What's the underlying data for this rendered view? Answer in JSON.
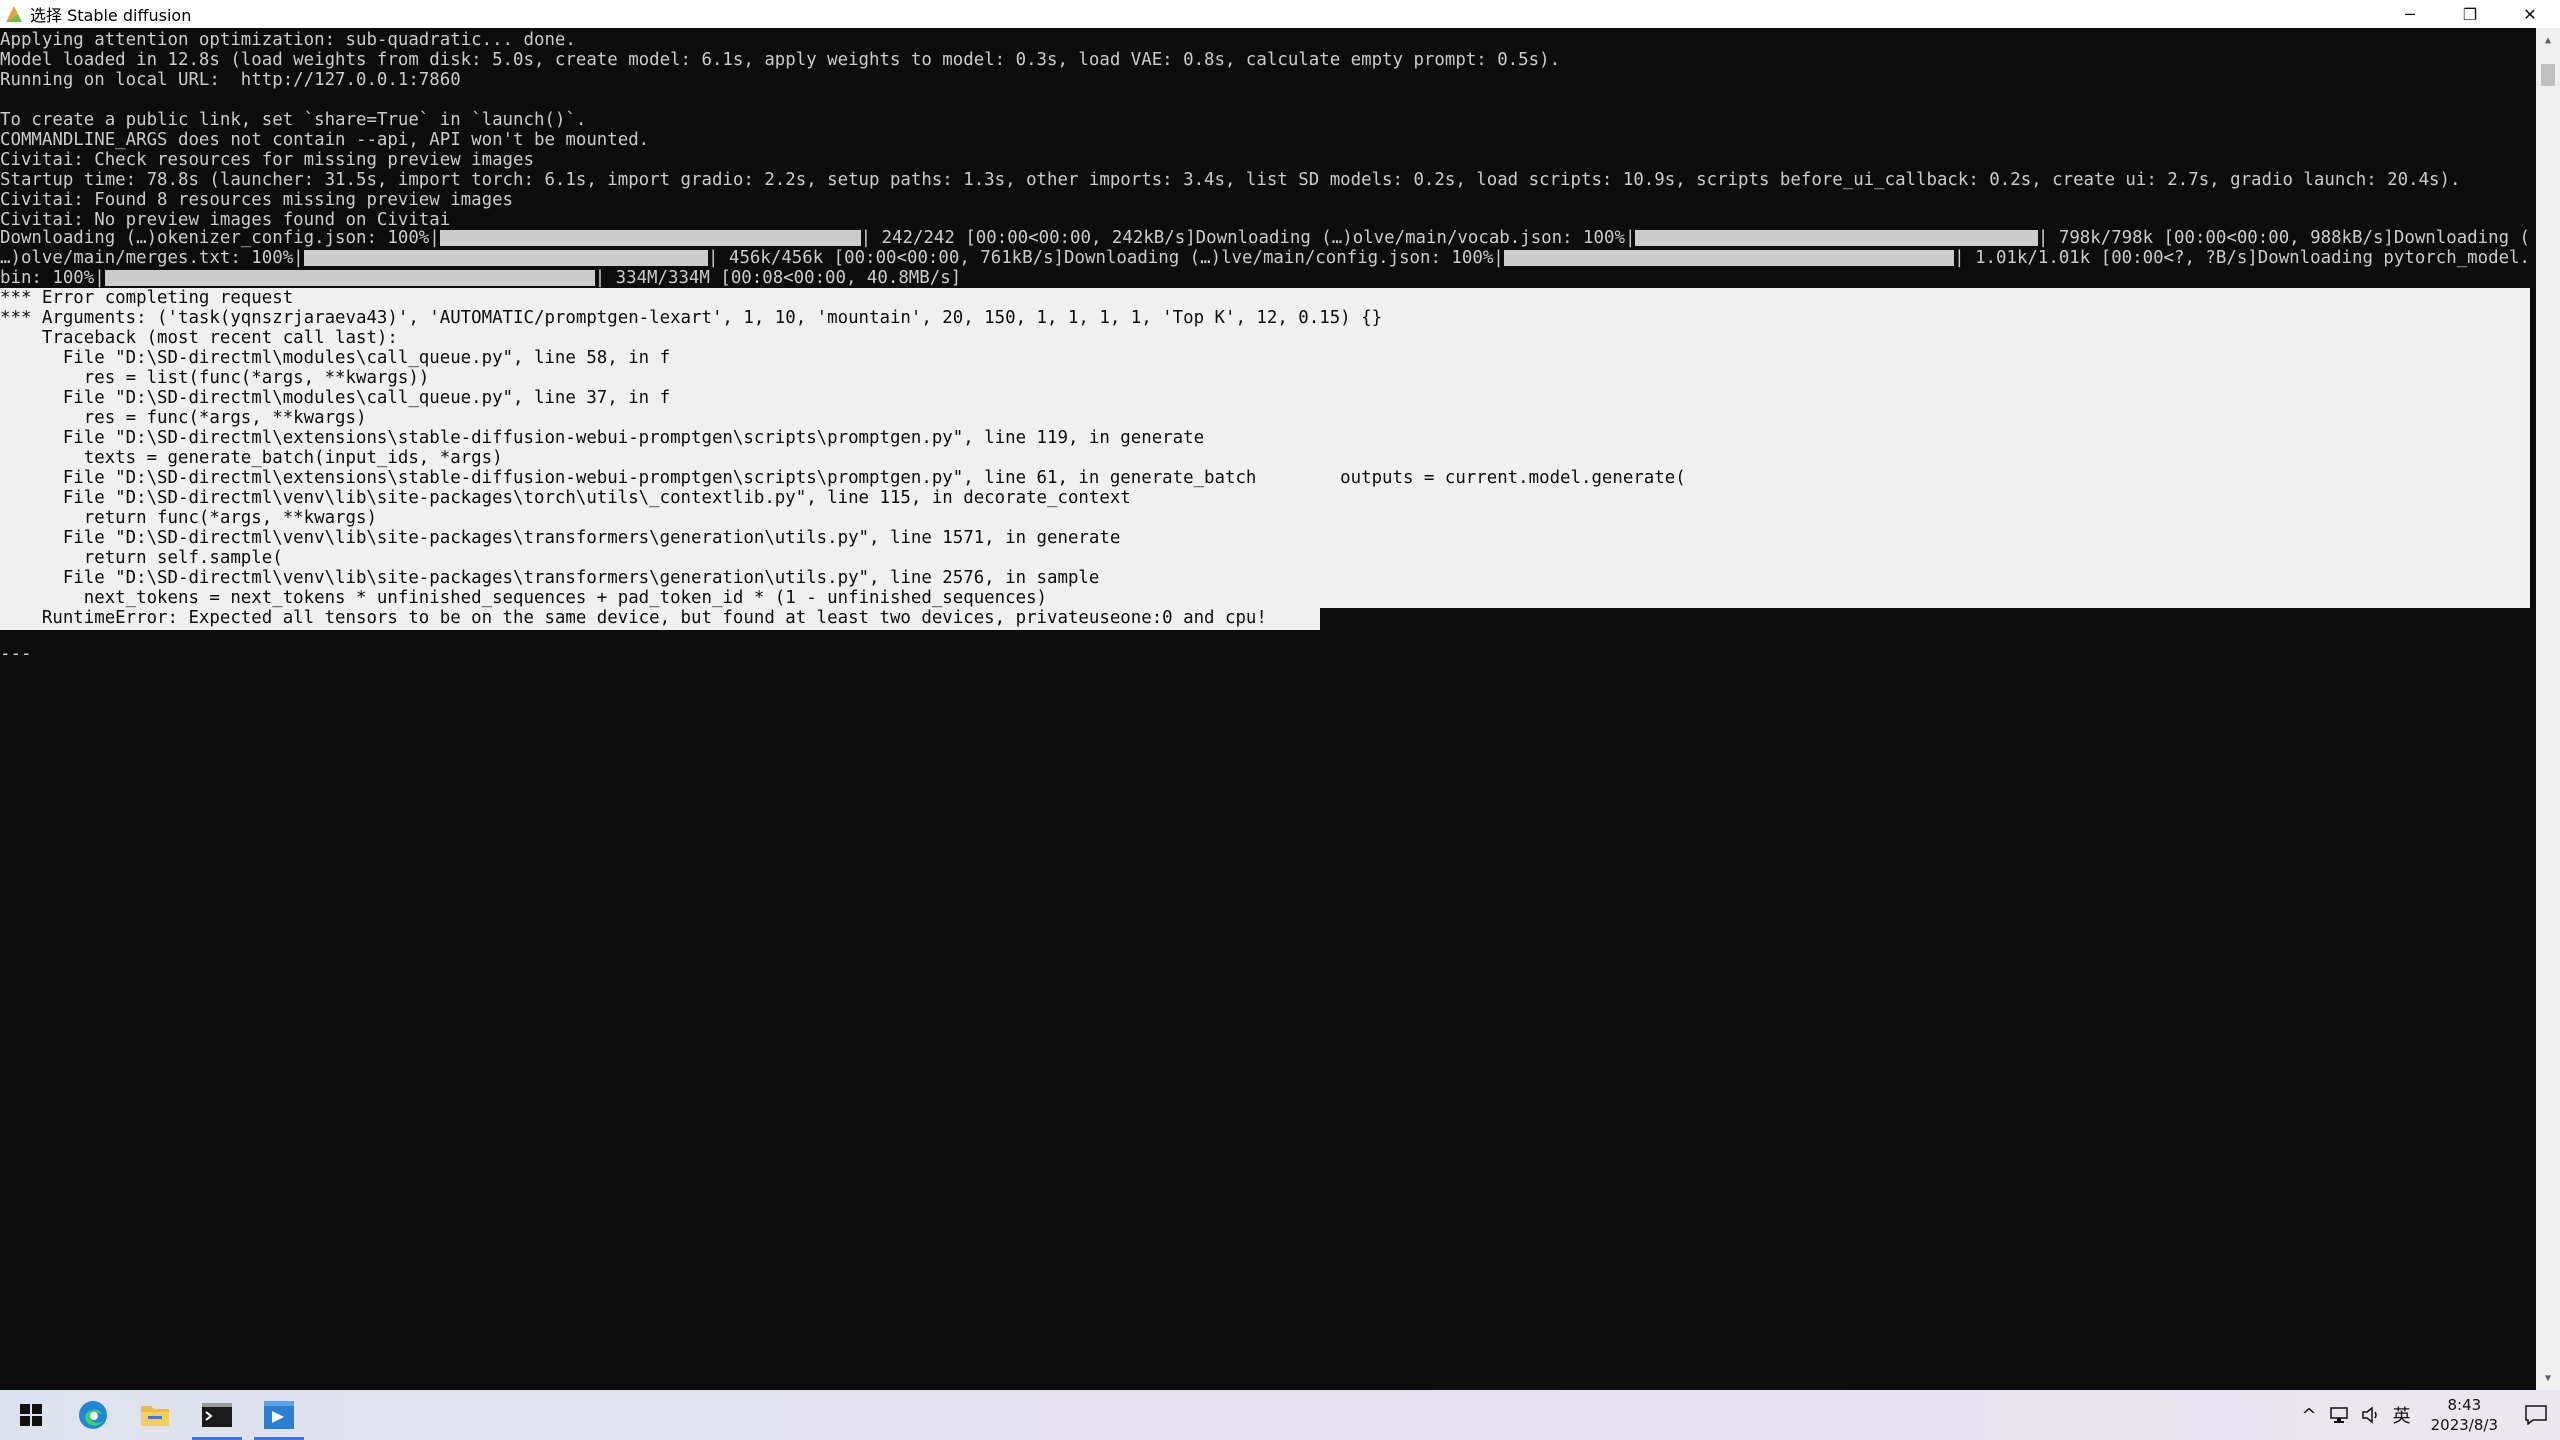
{
  "window": {
    "title": "选择 Stable diffusion",
    "minimize_glyph": "─",
    "maximize_glyph": "❐",
    "close_glyph": "✕"
  },
  "console": {
    "pre_lines": [
      "Applying attention optimization: sub-quadratic... done.",
      "Model loaded in 12.8s (load weights from disk: 5.0s, create model: 6.1s, apply weights to model: 0.3s, load VAE: 0.8s, calculate empty prompt: 0.5s).",
      "Running on local URL:  http://127.0.0.1:7860",
      "",
      "To create a public link, set `share=True` in `launch()`.",
      "COMMANDLINE_ARGS does not contain --api, API won't be mounted.",
      "Civitai: Check resources for missing preview images",
      "Startup time: 78.8s (launcher: 31.5s, import torch: 6.1s, import gradio: 2.2s, setup paths: 1.3s, other imports: 3.4s, list SD models: 0.2s, load scripts: 10.9s, scripts before_ui_callback: 0.2s, create ui: 2.7s, gradio launch: 20.4s).",
      "Civitai: Found 8 resources missing preview images",
      "Civitai: No preview images found on Civitai"
    ],
    "downloads": {
      "row1": {
        "a": "Downloading (…)okenizer_config.json: 100%|",
        "b": "| 242/242 [00:00<00:00, 242kB/s]Downloading (…)olve/main/vocab.json: 100%|",
        "c": "| 798k/798k [00:00<00:00, 988kB/s]Downloading ("
      },
      "row2": {
        "a": "…)olve/main/merges.txt: 100%|",
        "b": "| 456k/456k [00:00<00:00, 761kB/s]Downloading (…)lve/main/config.json: 100%|",
        "c": "| 1.01k/1.01k [00:00<?, ?B/s]Downloading pytorch_model."
      },
      "row3": {
        "a": "bin: 100%|",
        "b": "| 334M/334M [00:08<00:00, 40.8MB/s]"
      },
      "progress": [
        1.0,
        1.0,
        1.0,
        1.0,
        1.0,
        1.0
      ]
    },
    "error_lines": [
      "*** Error completing request",
      "*** Arguments: ('task(yqnszrjaraeva43)', 'AUTOMATIC/promptgen-lexart', 1, 10, 'mountain', 20, 150, 1, 1, 1, 1, 'Top K', 12, 0.15) {}",
      "    Traceback (most recent call last):",
      "      File \"D:\\SD-directml\\modules\\call_queue.py\", line 58, in f",
      "        res = list(func(*args, **kwargs))",
      "      File \"D:\\SD-directml\\modules\\call_queue.py\", line 37, in f",
      "        res = func(*args, **kwargs)",
      "      File \"D:\\SD-directml\\extensions\\stable-diffusion-webui-promptgen\\scripts\\promptgen.py\", line 119, in generate",
      "        texts = generate_batch(input_ids, *args)",
      "      File \"D:\\SD-directml\\extensions\\stable-diffusion-webui-promptgen\\scripts\\promptgen.py\", line 61, in generate_batch        outputs = current.model.generate(",
      "      File \"D:\\SD-directml\\venv\\lib\\site-packages\\torch\\utils\\_contextlib.py\", line 115, in decorate_context",
      "        return func(*args, **kwargs)",
      "      File \"D:\\SD-directml\\venv\\lib\\site-packages\\transformers\\generation\\utils.py\", line 1571, in generate",
      "        return self.sample(",
      "      File \"D:\\SD-directml\\venv\\lib\\site-packages\\transformers\\generation\\utils.py\", line 2576, in sample",
      "        next_tokens = next_tokens * unfinished_sequences + pad_token_id * (1 - unfinished_sequences)",
      "    RuntimeError: Expected all tensors to be on the same device, but found at least two devices, privateuseone:0 and cpu!"
    ],
    "separator": "---"
  },
  "taskbar": {
    "apps": [
      "start-icon",
      "edge-icon",
      "file-explorer-icon",
      "terminal-icon",
      "stable-diffusion-icon"
    ],
    "tray": {
      "chevron": "^",
      "ime": "英",
      "time": "8:43",
      "date": "2023/8/3"
    }
  }
}
